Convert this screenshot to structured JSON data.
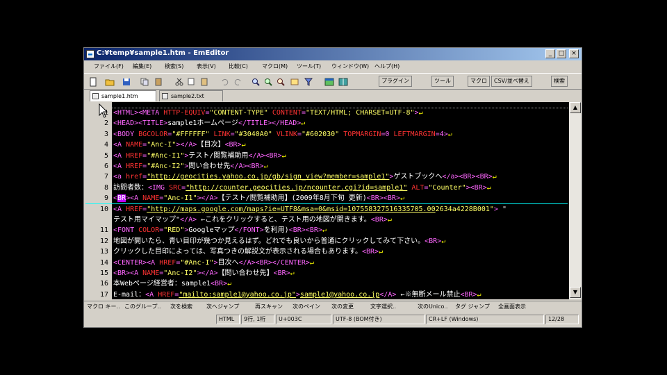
{
  "window": {
    "title": "C:¥temp¥sample1.htm - EmEditor"
  },
  "menu": [
    "ファイル(F)",
    "編集(E)",
    "検索(S)",
    "表示(V)",
    "比較(C)",
    "マクロ(M)",
    "ツール(T)",
    "ウィンドウ(W)",
    "ヘルプ(H)"
  ],
  "toolbar": {
    "buttons": [
      "プラグイン",
      "ツール",
      "マクロ",
      "CSV/並べ替え",
      "検索"
    ]
  },
  "tabs": [
    {
      "label": "sample1.htm",
      "active": true
    },
    {
      "label": "sample2.txt",
      "active": false
    }
  ],
  "editor": {
    "lines": [
      {
        "num": "1",
        "html": "<span class='tag'>&lt;HTML&gt;&lt;META </span><span class='attr'>HTTP-EQUIV</span><span class='tag'>=</span><span class='str'>\"CONTENT-TYPE\"</span><span class='attr'> CONTENT</span><span class='tag'>=</span><span class='str'>\"TEXT/HTML; CHARSET=UTF-8\"</span><span class='tag'>&gt;</span><span class='eol'>↵</span>"
      },
      {
        "num": "2",
        "html": "<span class='tag'>&lt;HEAD&gt;&lt;TITLE&gt;</span><span class='txt'>sample1ホームページ</span><span class='tag'>&lt;/TITLE&gt;&lt;/HEAD&gt;</span><span class='eol'>↵</span>"
      },
      {
        "num": "3",
        "html": "<span class='tag'>&lt;BODY </span><span class='attr'>BGCOLOR</span><span class='tag'>=</span><span class='str'>\"#FFFFFF\"</span><span class='attr'> LINK</span><span class='tag'>=</span><span class='str'>\"#3040A0\"</span><span class='attr'> VLINK</span><span class='tag'>=</span><span class='str'>\"#602030\"</span><span class='attr'> TOPMARGIN</span><span class='tag'>=0 </span><span class='attr'>LEFTMARGIN</span><span class='tag'>=4&gt;</span><span class='eol'>↵</span>"
      },
      {
        "num": "4",
        "html": "<span class='tag'>&lt;A </span><span class='attr'>NAME</span><span class='tag'>=</span><span class='str'>\"Anc-I\"</span><span class='tag'>&gt;&lt;/A&gt;</span><span class='txt'>【目次】</span><span class='tag'>&lt;BR&gt;</span><span class='eol'>↵</span>"
      },
      {
        "num": "5",
        "html": "<span class='tag'>&lt;A </span><span class='attr'>HREF</span><span class='tag'>=</span><span class='str'>\"#Anc-I1\"</span><span class='tag'>&gt;</span><span class='txt'>テスト/閲覧補助用</span><span class='tag'>&lt;/A&gt;&lt;BR&gt;</span><span class='eol'>↵</span>"
      },
      {
        "num": "6",
        "html": "<span class='tag'>&lt;A </span><span class='attr'>HREF</span><span class='tag'>=</span><span class='str'>\"#Anc-I2\"</span><span class='tag'>&gt;</span><span class='txt'>問い合わせ先</span><span class='tag'>&lt;/A&gt;&lt;BR&gt;</span><span class='eol'>↵</span>"
      },
      {
        "num": "7",
        "html": "<span class='tag'>&lt;a </span><span class='attr'>href</span><span class='tag'>=</span><span class='url'>\"http://geocities.yahoo.co.jp/gb/sign_view?member=sample1\"</span><span class='tag'>&gt;</span><span class='txt'>ゲストブックへ</span><span class='tag'>&lt;/a&gt;&lt;BR&gt;&lt;BR&gt;</span><span class='eol'>↵</span>"
      },
      {
        "num": "8",
        "html": "<span class='txt'>訪問者数：</span><span class='tag'>&lt;IMG </span><span class='attr'>SRC</span><span class='tag'>=</span><span class='url'>\"http://counter.geocities.jp/ncounter.cgi?id=sample1\"</span><span class='attr'> ALT</span><span class='tag'>=</span><span class='str'>\"Counter\"</span><span class='tag'>&gt;&lt;BR&gt;</span><span class='eol'>↵</span>"
      },
      {
        "num": "9",
        "cursor": true,
        "html": "<span class='tag'>&lt;</span><span class='hl'>BR</span><span class='tag'>&gt;&lt;A </span><span class='attr'>NAME</span><span class='tag'>=</span><span class='str'>\"Anc-I1\"</span><span class='tag'>&gt;&lt;/A&gt;</span><span class='txt'>【テスト/閲覧補助用】(2009年8月下旬 更新)</span><span class='tag'>&lt;BR&gt;&lt;BR&gt;</span><span class='eol'>↵</span>"
      },
      {
        "num": "10",
        "html": "<span class='tag'>&lt;A </span><span class='attr'>HREF</span><span class='tag'>=</span><span class='url'>\"http://maps.google.com/maps?ie=UTF8&amp;msa=0&amp;msid=107558327516335705.00</span><span class='str'>2634a4228B001\"</span><span class='tag'>&gt;</span><span class='txt'> \"</span>"
      },
      {
        "num": "",
        "html": "<span class='txt'>テスト用マイマップ\"</span><span class='tag'>&lt;/A&gt;</span><span class='txt'> ←これをクリックすると、テスト用の地図が開きます。</span><span class='tag'>&lt;BR&gt;</span><span class='eol'>↵</span>"
      },
      {
        "num": "11",
        "html": "<span class='tag'>&lt;FONT </span><span class='attr'>COLOR</span><span class='tag'>=</span><span class='str'>\"RED\"</span><span class='tag'>&gt;</span><span class='txt'>Googleマップ</span><span class='tag'>&lt;/FONT&gt;</span><span class='txt'>を利用)</span><span class='tag'>&lt;BR&gt;&lt;BR&gt;</span><span class='eol'>↵</span>"
      },
      {
        "num": "12",
        "html": "<span class='txt'>地図が開いたら、青い目印が幾つか見えるはず。どれでも良いから普通にクリックしてみて下さい。</span><span class='tag'>&lt;BR&gt;</span><span class='eol'>↵</span>"
      },
      {
        "num": "13",
        "html": "<span class='txt'>クリックした目印によっては、写真つきの解説文が表示される場合もあります。</span><span class='tag'>&lt;BR&gt;</span><span class='eol'>↵</span>"
      },
      {
        "num": "14",
        "html": "<span class='tag'>&lt;CENTER&gt;&lt;A </span><span class='attr'>HREF</span><span class='tag'>=</span><span class='str'>\"#Anc-I\"</span><span class='tag'>&gt;</span><span class='txt'>目次へ</span><span class='tag'>&lt;/A&gt;&lt;BR&gt;&lt;/CENTER&gt;</span><span class='eol'>↵</span>"
      },
      {
        "num": "15",
        "html": "<span class='tag'>&lt;BR&gt;&lt;A </span><span class='attr'>NAME</span><span class='tag'>=</span><span class='str'>\"Anc-I2\"</span><span class='tag'>&gt;&lt;/A&gt;</span><span class='txt'>【問い合わせ先】</span><span class='tag'>&lt;BR&gt;</span><span class='eol'>↵</span>"
      },
      {
        "num": "16",
        "html": "<span class='txt'>本Webページ経営者：sample1</span><span class='tag'>&lt;BR&gt;</span><span class='eol'>↵</span>"
      },
      {
        "num": "17",
        "html": "<span class='txt'>E-mail：</span><span class='tag'>&lt;A </span><span class='attr'>HREF</span><span class='tag'>=</span><span class='url'>\"mailto:sample1@yahoo.co.jp\"</span><span class='tag'>&gt;</span><span class='url'>sample1@yahoo.co.jp</span><span class='tag'>&lt;/A&gt;</span><span class='txt'> ←※無断メール禁止</span><span class='tag'>&lt;BR&gt;</span><span class='eol'>↵</span>"
      }
    ]
  },
  "fkeys": [
    "マクロ キー..",
    "このグループ..",
    "次を検索",
    "次へジャンプ",
    "再スキャン",
    "次のペイン",
    "次の変更",
    "文字選択..",
    "次のUnico..",
    "タグ ジャンプ",
    "全画面表示"
  ],
  "status": [
    "HTML",
    "9行, 1桁",
    "U+003C",
    "UTF-8 (BOM付き)",
    "CR+LF (Windows)",
    "12/28"
  ]
}
